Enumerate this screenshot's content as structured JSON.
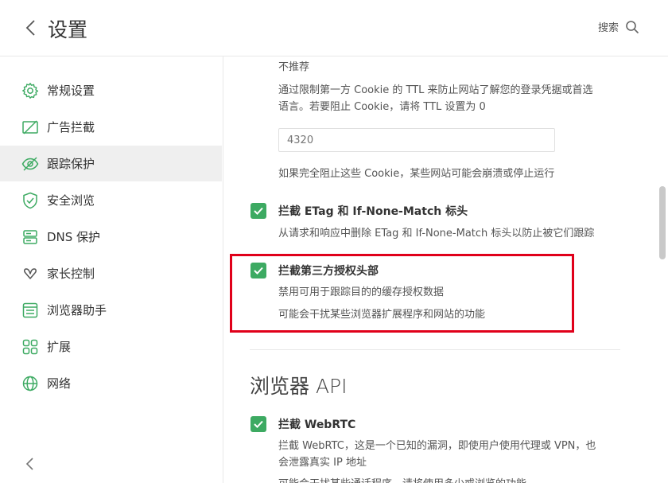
{
  "header": {
    "title": "设置",
    "search_label": "搜索"
  },
  "sidebar": {
    "items": [
      {
        "label": "常规设置",
        "icon": "gear-icon"
      },
      {
        "label": "广告拦截",
        "icon": "ad-block-icon"
      },
      {
        "label": "跟踪保护",
        "icon": "eye-slash-icon",
        "active": true
      },
      {
        "label": "安全浏览",
        "icon": "shield-icon"
      },
      {
        "label": "DNS 保护",
        "icon": "dns-server-icon"
      },
      {
        "label": "家长控制",
        "icon": "parental-control-icon"
      },
      {
        "label": "浏览器助手",
        "icon": "browser-assistant-icon"
      },
      {
        "label": "扩展",
        "icon": "extensions-grid-icon"
      },
      {
        "label": "网络",
        "icon": "globe-icon"
      }
    ]
  },
  "main": {
    "cookie_ttl": {
      "warning": "不推荐",
      "desc_line1": "通过限制第一方 Cookie 的 TTL 来防止网站了解您的登录凭据或首选",
      "desc_line2": "语言。若要阻止 Cookie，请将 TTL 设置为 0",
      "input_placeholder": "4320",
      "note": "如果完全阻止这些 Cookie，某些网站可能会崩溃或停止运行"
    },
    "etag": {
      "title": "拦截 ETag 和 If-None-Match 标头",
      "desc": "从请求和响应中删除 ETag 和 If-None-Match 标头以防止被它们跟踪",
      "checked": true
    },
    "auth_header": {
      "title": "拦截第三方授权头部",
      "desc": "禁用可用于跟踪目的的缓存授权数据",
      "warning": "可能会干扰某些浏览器扩展程序和网站的功能",
      "checked": true
    },
    "browser_api": {
      "section_title": "浏览器 API",
      "webrtc_title": "拦截 WebRTC",
      "webrtc_desc_line1": "拦截 WebRTC，这是一个已知的漏洞，即使用户使用代理或 VPN，也",
      "webrtc_desc_line2": "会泄露真实 IP 地址",
      "webrtc_warning": "可能会干扰某些通话程序，请将使用多少或浏览的功能",
      "webrtc_checked": true
    }
  },
  "colors": {
    "accent": "#3daa62",
    "warning": "#e53935",
    "highlight_border": "#e0001a"
  }
}
